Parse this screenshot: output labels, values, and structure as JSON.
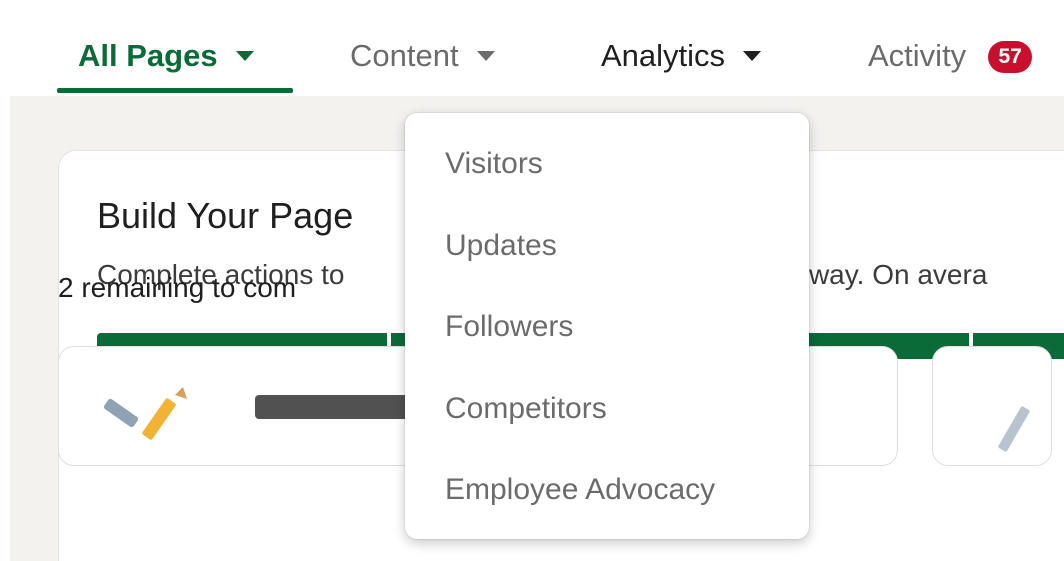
{
  "nav": {
    "tabs": [
      {
        "label": "All Pages",
        "active": true
      },
      {
        "label": "Content"
      },
      {
        "label": "Analytics",
        "open": true
      },
      {
        "label": "Activity",
        "badge": "57"
      }
    ]
  },
  "card": {
    "title": "Build Your Page",
    "subtitle": "Complete actions to ",
    "subtitle_tail": "the way. On avera",
    "remaining": "2 remaining to com"
  },
  "analytics_menu": {
    "items": [
      "Visitors",
      "Updates",
      "Followers",
      "Competitors",
      "Employee Advocacy"
    ]
  },
  "colors": {
    "brand_green": "#0a6b38",
    "badge_red": "#c8102e",
    "page_bg": "#f3f2ef"
  }
}
